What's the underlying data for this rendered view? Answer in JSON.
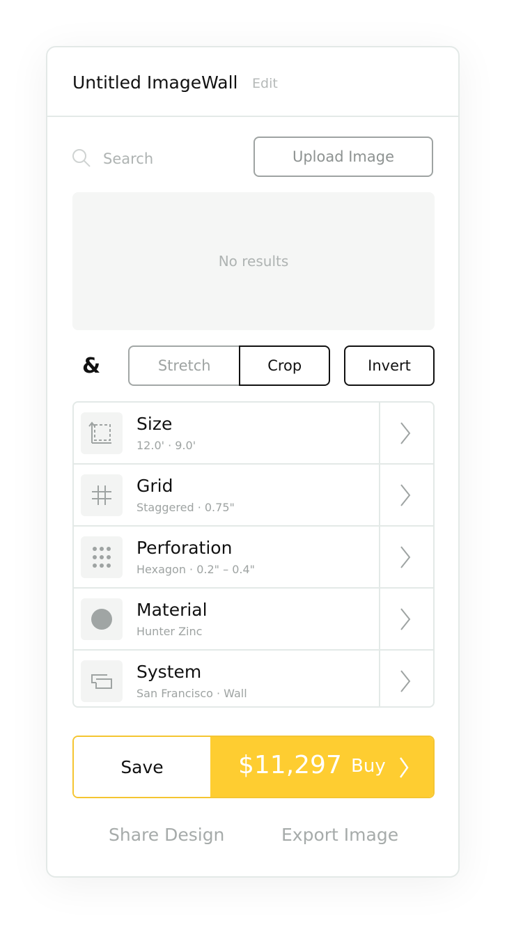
{
  "header": {
    "title": "Untitled ImageWall",
    "edit_label": "Edit"
  },
  "search": {
    "placeholder": "Search",
    "icon": "search-icon"
  },
  "upload": {
    "label": "Upload Image"
  },
  "results": {
    "empty_text": "No results"
  },
  "fit_modes": {
    "ampersand": "&",
    "stretch_label": "Stretch",
    "crop_label": "Crop",
    "selected": "Crop",
    "invert_label": "Invert"
  },
  "settings": [
    {
      "title": "Size",
      "subtitle": "12.0' · 9.0'",
      "icon": "size-icon"
    },
    {
      "title": "Grid",
      "subtitle": "Staggered · 0.75\"",
      "icon": "grid-icon"
    },
    {
      "title": "Perforation",
      "subtitle": "Hexagon  · 0.2\" – 0.4\"",
      "icon": "perforation-icon"
    },
    {
      "title": "Material",
      "subtitle": "Hunter Zinc",
      "icon": "material-swatch-icon"
    },
    {
      "title": "System",
      "subtitle": "San Francisco · Wall",
      "icon": "system-icon"
    }
  ],
  "actions": {
    "save_label": "Save",
    "price": "$11,297",
    "buy_label": "Buy"
  },
  "footer": {
    "share_label": "Share Design",
    "export_label": "Export Image"
  },
  "colors": {
    "accent": "#fecd31",
    "border": "#e3e9e7",
    "muted_text": "#a6abaa"
  }
}
